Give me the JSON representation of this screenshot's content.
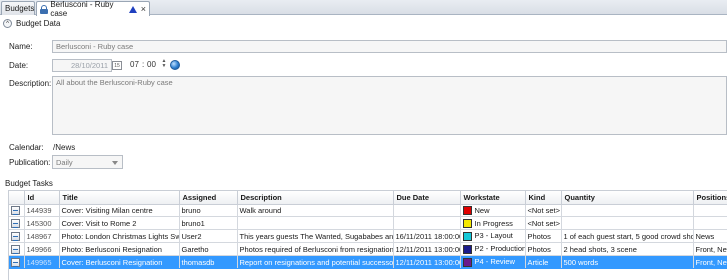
{
  "tabs": {
    "budgets_label": "Budgets",
    "active_label": "Berlusconi - Ruby case",
    "close_glyph": "×"
  },
  "section": {
    "title": "Budget Data",
    "collapse_glyph": "^"
  },
  "form": {
    "name_label": "Name:",
    "name_value": "Berlusconi - Ruby case",
    "date_label": "Date:",
    "date_value": "28/10/2011",
    "calendar_icon_text": "15",
    "time_hours": "07",
    "time_sep": ":",
    "time_minutes": "00",
    "description_label": "Description:",
    "description_value": "All about the Berlusconi-Ruby case",
    "calendar_label": "Calendar:",
    "calendar_value": "/News",
    "publication_label": "Publication:",
    "publication_value": "Daily"
  },
  "tasks": {
    "section_label": "Budget Tasks",
    "columns": [
      "",
      "Id",
      "Title",
      "Assigned",
      "Description",
      "Due Date",
      "Workstate",
      "Kind",
      "Quantity",
      "Positions"
    ],
    "rows": [
      {
        "id": "144939",
        "title": "Cover: Visiting Milan centre",
        "assigned": "bruno",
        "description": "Walk around",
        "due": "",
        "workstate": "New",
        "ws_color": "#e00000",
        "kind": "<Not set>",
        "quantity": "",
        "positions": ""
      },
      {
        "id": "145300",
        "title": "Cover: Visit to Rome 2",
        "assigned": "bruno1",
        "description": "",
        "due": "",
        "workstate": "In Progress",
        "ws_color": "#f5e800",
        "kind": "<Not set>",
        "quantity": "",
        "positions": ""
      },
      {
        "id": "148967",
        "title": "Photo: London Christmas Lights Switch",
        "assigned": "User2",
        "description": "This years guests The Wanted, Sugababes and Cheryl",
        "due": "16/11/2011 18:00:00",
        "workstate": "P3 - Layout",
        "ws_color": "#14c8d8",
        "kind": "Photos",
        "quantity": "1 of each guest start, 5 good crowd shots",
        "positions": "News"
      },
      {
        "id": "149966",
        "title": "Photo: Berlusconi Resignation",
        "assigned": "Garetho",
        "description": "Photos required of Berlusconi from resignation",
        "due": "12/11/2011 13:00:00",
        "workstate": "P2 - Production",
        "ws_color": "#1a1a8c",
        "kind": "Photos",
        "quantity": "2 head shots, 3 scene",
        "positions": "Front, News"
      },
      {
        "id": "149965",
        "title": "Cover: Berlusconi Resignation",
        "assigned": "thomasdb",
        "description": "Report on resignations and potential successor",
        "due": "12/11/2011 13:00:00",
        "workstate": "P4 - Review",
        "ws_color": "#6a1a8c",
        "kind": "Article",
        "quantity": "500 words",
        "positions": "Front, News"
      }
    ]
  },
  "colors": {
    "selection": "#3399ff",
    "accent": "#1f3fbf"
  }
}
